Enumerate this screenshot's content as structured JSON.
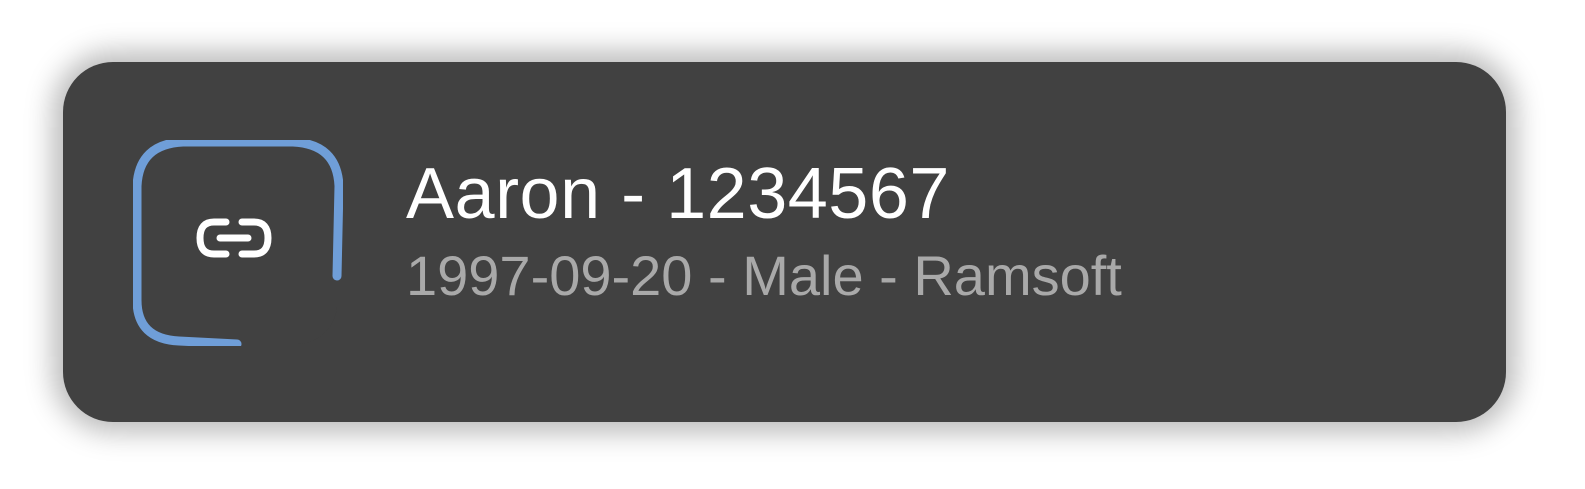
{
  "patient_card": {
    "title": "Aaron - 1234567",
    "subtitle": "1997-09-20 - Male - Ramsoft",
    "icon": "link-icon",
    "colors": {
      "card_background": "#414141",
      "accent": "#6f9ed8",
      "title_text": "#ffffff",
      "subtitle_text": "#a9a9a9"
    }
  }
}
